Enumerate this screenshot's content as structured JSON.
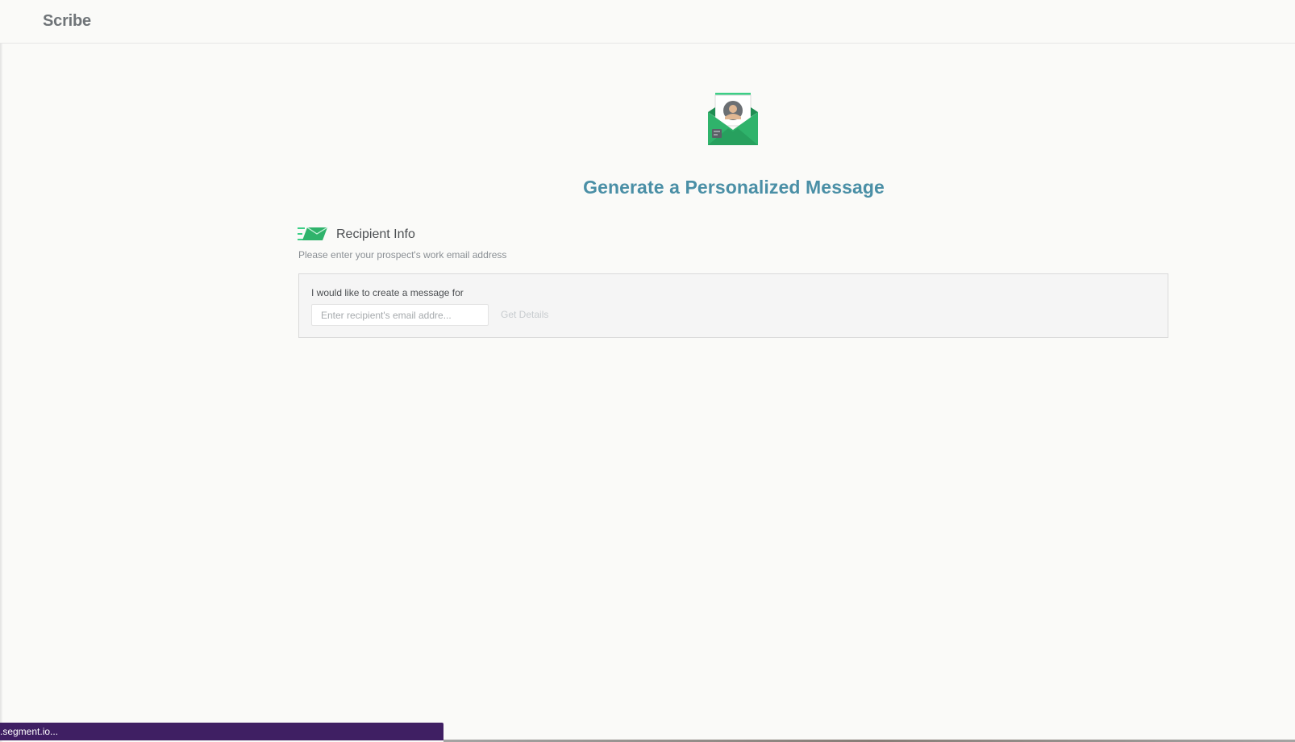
{
  "app": {
    "brand": "Scribe"
  },
  "hero": {
    "icon": "personalized-mail-icon",
    "title": "Generate a Personalized Message"
  },
  "recipient_section": {
    "icon": "fast-mail-icon",
    "title": "Recipient Info",
    "subtitle": "Please enter your prospect's work email address",
    "form": {
      "label": "I would like to create a message for",
      "email_input": {
        "value": "",
        "placeholder": "Enter recipient's email addre..."
      },
      "submit_label": "Get Details"
    }
  },
  "status_bar": {
    "text": ".segment.io..."
  },
  "colors": {
    "brand_text": "#6f7478",
    "title_accent": "#4a8fa6",
    "icon_green": "#2fb36b",
    "status_bar": "#3f1f63"
  }
}
